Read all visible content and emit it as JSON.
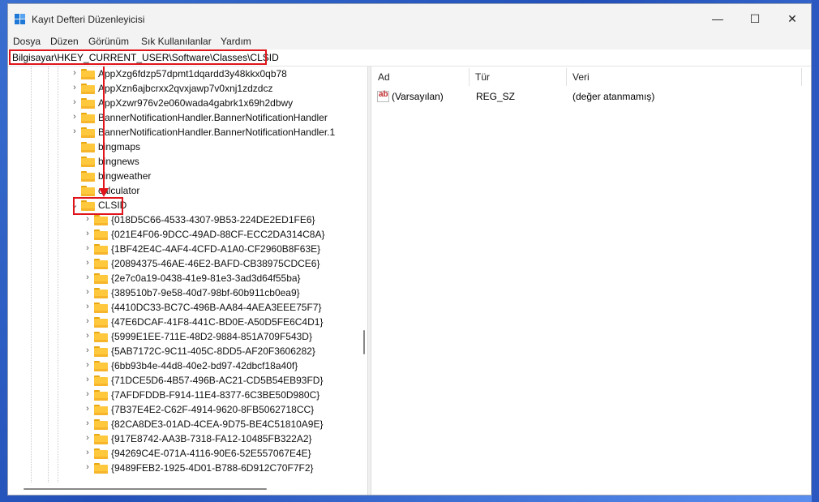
{
  "window": {
    "title": "Kayıt Defteri Düzenleyicisi",
    "controls": {
      "minimize": "—",
      "maximize": "☐",
      "close": "✕"
    }
  },
  "menu": [
    "Dosya",
    "Düzen",
    "Görünüm",
    "Sık Kullanılanlar",
    "Yardım"
  ],
  "address": {
    "path": "Bilgisayar\\HKEY_CURRENT_USER\\Software\\Classes\\CLSID"
  },
  "tree": {
    "upper_items": [
      {
        "label": "AppXzg6fdzp57dpmt1dqardd3y48kkx0qb78",
        "expandable": true
      },
      {
        "label": "AppXzn6ajbcrxx2qvxjawp7v0xnj1zdzdcz",
        "expandable": true
      },
      {
        "label": "AppXzwr976v2e060wada4gabrk1x69h2dbwy",
        "expandable": true
      },
      {
        "label": "BannerNotificationHandler.BannerNotificationHandler",
        "expandable": true
      },
      {
        "label": "BannerNotificationHandler.BannerNotificationHandler.1",
        "expandable": true
      },
      {
        "label": "bingmaps",
        "expandable": false
      },
      {
        "label": "bingnews",
        "expandable": false
      },
      {
        "label": "bingweather",
        "expandable": false
      },
      {
        "label": "calculator",
        "expandable": false
      }
    ],
    "selected": {
      "label": "CLSID",
      "expanded": true
    },
    "children": [
      "{018D5C66-4533-4307-9B53-224DE2ED1FE6}",
      "{021E4F06-9DCC-49AD-88CF-ECC2DA314C8A}",
      "{1BF42E4C-4AF4-4CFD-A1A0-CF2960B8F63E}",
      "{20894375-46AE-46E2-BAFD-CB38975CDCE6}",
      "{2e7c0a19-0438-41e9-81e3-3ad3d64f55ba}",
      "{389510b7-9e58-40d7-98bf-60b911cb0ea9}",
      "{4410DC33-BC7C-496B-AA84-4AEA3EEE75F7}",
      "{47E6DCAF-41F8-441C-BD0E-A50D5FE6C4D1}",
      "{5999E1EE-711E-48D2-9884-851A709F543D}",
      "{5AB7172C-9C11-405C-8DD5-AF20F3606282}",
      "{6bb93b4e-44d8-40e2-bd97-42dbcf18a40f}",
      "{71DCE5D6-4B57-496B-AC21-CD5B54EB93FD}",
      "{7AFDFDDB-F914-11E4-8377-6C3BE50D980C}",
      "{7B37E4E2-C62F-4914-9620-8FB5062718CC}",
      "{82CA8DE3-01AD-4CEA-9D75-BE4C51810A9E}",
      "{917E8742-AA3B-7318-FA12-10485FB322A2}",
      "{94269C4E-071A-4116-90E6-52E557067E4E}",
      "{9489FEB2-1925-4D01-B788-6D912C70F7F2}"
    ]
  },
  "list": {
    "columns": [
      "Ad",
      "Tür",
      "Veri"
    ],
    "rows": [
      {
        "name": "(Varsayılan)",
        "type": "REG_SZ",
        "data": "(değer atanmamış)"
      }
    ]
  },
  "icons": {
    "folder": "folder-icon",
    "string_value": "reg-sz-icon",
    "app": "registry-editor-icon"
  },
  "colors": {
    "highlight": "#e0151b",
    "folder": "#ffc83d",
    "desktop": "#2250b8"
  }
}
